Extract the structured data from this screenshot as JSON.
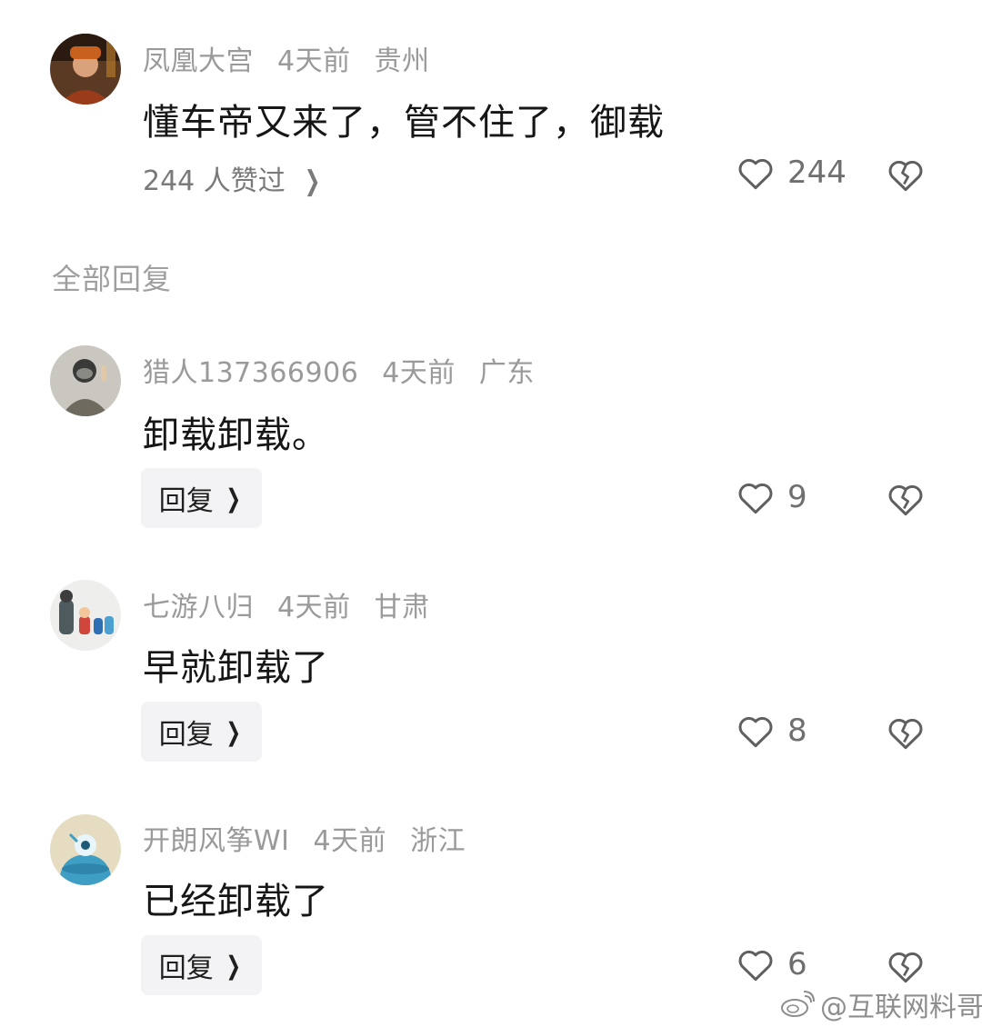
{
  "main_comment": {
    "username": "凤凰大宫",
    "time": "4天前",
    "location": "贵州",
    "text": "懂车帝又来了，管不住了，御载",
    "likers_text": "244 人赞过",
    "likes": "244"
  },
  "section_label": "全部回复",
  "replies": [
    {
      "username": "猎人137366906",
      "time": "4天前",
      "location": "广东",
      "text": "卸载卸载。",
      "reply_label": "回复",
      "likes": "9"
    },
    {
      "username": "七游八归",
      "time": "4天前",
      "location": "甘肃",
      "text": "早就卸载了",
      "reply_label": "回复",
      "likes": "8"
    },
    {
      "username": "开朗风筝WI",
      "time": "4天前",
      "location": "浙江",
      "text": "已经卸载了",
      "reply_label": "回复",
      "likes": "6"
    }
  ],
  "watermark": "@互联网料哥",
  "icons": {
    "like": "heart-outline-icon",
    "dislike": "broken-heart-icon",
    "chevron": "chevron-right-icon",
    "watermark": "weibo-logo-icon"
  },
  "colors": {
    "text": "#161616",
    "meta": "#9a9a9a",
    "reply_bg": "#f3f3f5"
  }
}
